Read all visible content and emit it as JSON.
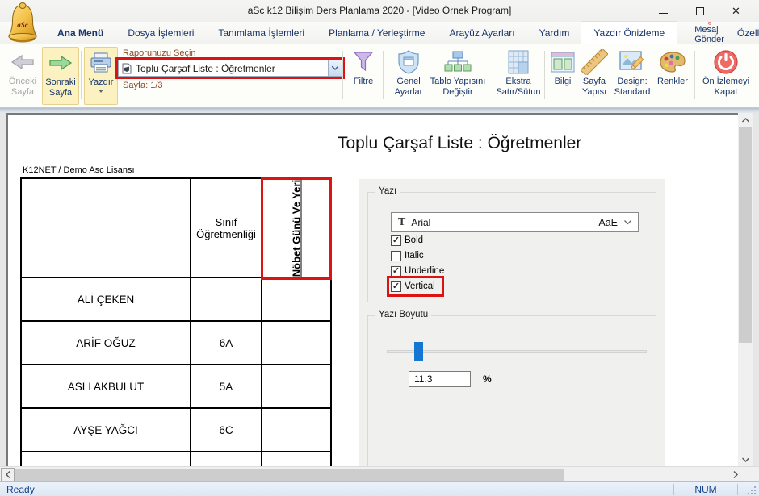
{
  "window": {
    "title": "aSc k12 Bilişim Ders Planlama 2020 - [Video Örnek Program]",
    "logo": "aSc"
  },
  "tabs": {
    "items": [
      "Ana Menü",
      "Dosya İşlemleri",
      "Tanımlama İşlemleri",
      "Planlama / Yerleştirme",
      "Arayüz Ayarları",
      "Yardım",
      "Yazdır Önizleme"
    ],
    "active": "Yazdır Önizleme",
    "message": "Mesaj Gönder",
    "customize": "Özelleştir"
  },
  "ribbon": {
    "prev": "Önceki Sayfa",
    "next": "Sonraki Sayfa",
    "print": "Yazdır",
    "report_picker_label": "Raporunuzu Seçin",
    "report_value": "Toplu Çarşaf Liste : Öğretmenler",
    "page_indicator": "Sayfa: 1/3",
    "filter": "Filtre",
    "general_settings": "Genel Ayarlar",
    "change_table_structure": "Tablo Yapısını Değiştir",
    "extra_row_col": "Ekstra Satır/Sütun",
    "info": "Bilgi",
    "page_setup": "Sayfa Yapısı",
    "design": "Design: Standard",
    "colors_btn": "Renkler",
    "close_preview": "Ön İzlemeyi Kapat"
  },
  "preview": {
    "report_title": "Toplu Çarşaf Liste : Öğretmenler",
    "license": "K12NET / Demo Asc Lisansı",
    "table": {
      "col2_header": "Sınıf Öğretmenliği",
      "col3_header": "Nöbet Günü Ve Yeri",
      "rows": [
        {
          "name": "ALİ ÇEKEN",
          "class": ""
        },
        {
          "name": "ARİF OĞUZ",
          "class": "6A"
        },
        {
          "name": "ASLI AKBULUT",
          "class": "5A"
        },
        {
          "name": "AYŞE YAĞCI",
          "class": "6C"
        }
      ]
    }
  },
  "panel": {
    "font_group": "Yazı",
    "font_name": "Arial",
    "font_sample": "AaE",
    "checkboxes": [
      {
        "label": "Bold",
        "mark": "✓"
      },
      {
        "label": "Italic",
        "mark": ""
      },
      {
        "label": "Underline",
        "mark": "✓"
      },
      {
        "label": "Vertical",
        "mark": "✓"
      }
    ],
    "size_group": "Yazı Boyutu",
    "size_value": "11.3",
    "size_unit": "%"
  },
  "statusbar": {
    "ready": "Ready",
    "num": "NUM"
  },
  "colors": {
    "annotation_red": "#dd1212",
    "ribbon_highlight": "#fcf1c0",
    "slider_blue": "#1577d2",
    "tab_text": "#17356b"
  }
}
